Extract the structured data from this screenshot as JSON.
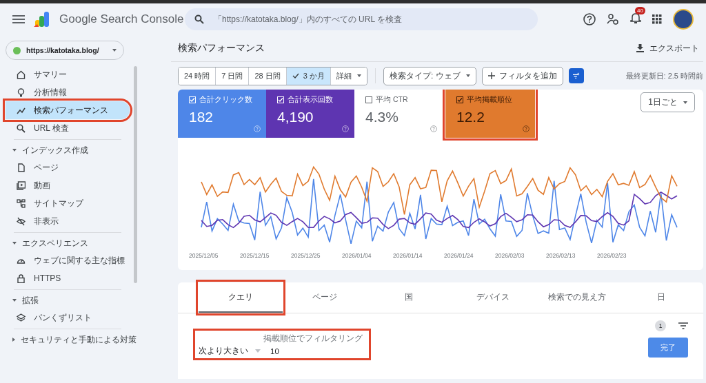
{
  "header": {
    "app_name": "Google Search Console",
    "search": {
      "placeholder": "「https://katotaka.blog/」内のすべての URL を検査"
    },
    "notification_count": "40"
  },
  "sidebar": {
    "property": "https://katotaka.blog/",
    "items": [
      {
        "kind": "link",
        "label": "サマリー",
        "selected": false,
        "highlighted": false
      },
      {
        "kind": "link",
        "label": "分析情報",
        "selected": false,
        "highlighted": false
      },
      {
        "kind": "link",
        "label": "検索パフォーマンス",
        "selected": true,
        "highlighted": true
      },
      {
        "kind": "link",
        "label": "URL 検査",
        "selected": false,
        "highlighted": false
      },
      {
        "kind": "section",
        "label": "インデックス作成",
        "expanded": true
      },
      {
        "kind": "link",
        "label": "ページ",
        "selected": false,
        "highlighted": false
      },
      {
        "kind": "link",
        "label": "動画",
        "selected": false,
        "highlighted": false
      },
      {
        "kind": "link",
        "label": "サイトマップ",
        "selected": false,
        "highlighted": false
      },
      {
        "kind": "link",
        "label": "非表示",
        "selected": false,
        "highlighted": false
      },
      {
        "kind": "section",
        "label": "エクスペリエンス",
        "expanded": true
      },
      {
        "kind": "link",
        "label": "ウェブに関する主な指標",
        "selected": false,
        "highlighted": false
      },
      {
        "kind": "link",
        "label": "HTTPS",
        "selected": false,
        "highlighted": false
      },
      {
        "kind": "section",
        "label": "拡張",
        "expanded": true
      },
      {
        "kind": "link",
        "label": "パンくずリスト",
        "selected": false,
        "highlighted": false
      },
      {
        "kind": "section",
        "label": "セキュリティと手動による対策",
        "expanded": false
      }
    ]
  },
  "main": {
    "title": "検索パフォーマンス",
    "export_label": "エクスポート",
    "date_ranges": [
      {
        "label": "24 時間",
        "selected": false
      },
      {
        "label": "7 日間",
        "selected": false
      },
      {
        "label": "28 日間",
        "selected": false
      },
      {
        "label": "3 か月",
        "selected": true
      },
      {
        "label": "詳細",
        "selected": false
      }
    ],
    "search_type": "検索タイプ: ウェブ",
    "add_filter": "フィルタを追加",
    "last_updated": "最終更新日: 2.5 時間前",
    "metrics": [
      {
        "label": "合計クリック数",
        "value": "182",
        "checked": true,
        "color": "#4e86e8",
        "highlighted": false
      },
      {
        "label": "合計表示回数",
        "value": "4,190",
        "checked": true,
        "color": "#5e35b1",
        "highlighted": false
      },
      {
        "label": "平均 CTR",
        "value": "4.3%",
        "checked": false,
        "highlighted": false
      },
      {
        "label": "平均掲載順位",
        "value": "12.2",
        "checked": true,
        "color": "#e07a2e",
        "highlighted": true
      }
    ],
    "granularity": "1日ごと",
    "chart": {
      "x_labels": [
        "2025/12/05",
        "2025/12/15",
        "2025/12/25",
        "2026/01/04",
        "2026/01/14",
        "2026/01/24",
        "2026/02/03",
        "2026/02/13",
        "2026/02/23"
      ]
    },
    "tabs": [
      {
        "label": "クエリ",
        "selected": true,
        "highlighted": true
      },
      {
        "label": "ページ",
        "selected": false,
        "highlighted": false
      },
      {
        "label": "国",
        "selected": false,
        "highlighted": false
      },
      {
        "label": "デバイス",
        "selected": false,
        "highlighted": false
      },
      {
        "label": "検索での見え方",
        "selected": false,
        "highlighted": false
      },
      {
        "label": "日",
        "selected": false,
        "highlighted": false
      }
    ],
    "filter_count": "1",
    "filter": {
      "label": "掲載順位でフィルタリング",
      "operator": "次より大きい",
      "value": "10",
      "highlighted": true
    },
    "done_button": "完了"
  }
}
